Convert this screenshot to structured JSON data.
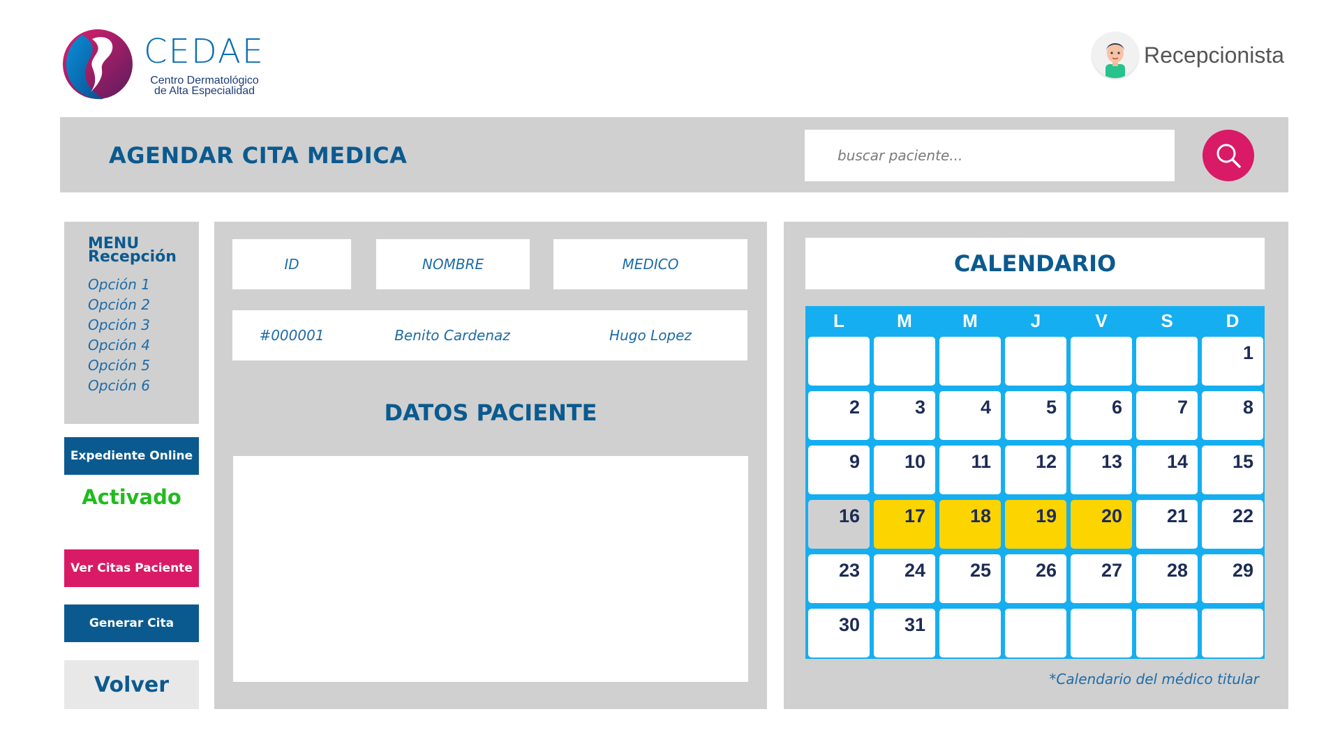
{
  "brand": {
    "name": "CEDAE",
    "subtitle_line1": "Centro Dermatológico",
    "subtitle_line2": "de Alta Especialidad",
    "colors": {
      "blue": "#0a6fb1",
      "magenta": "#d91a66"
    }
  },
  "user": {
    "role": "Recepcionista",
    "avatar_icon": "user-avatar-icon"
  },
  "header": {
    "title": "AGENDAR CITA MEDICA",
    "search_placeholder": "buscar paciente...",
    "search_icon": "search-icon"
  },
  "menu": {
    "title_line1": "MENU",
    "title_line2": "Recepción",
    "items": [
      "Opción 1",
      "Opción 2",
      "Opción 3",
      "Opción 4",
      "Opción 5",
      "Opción 6"
    ]
  },
  "actions": {
    "expediente_label": "Expediente Online",
    "expediente_status": "Activado",
    "ver_citas_label": "Ver Citas Paciente",
    "generar_cita_label": "Generar Cita",
    "volver_label": "Volver"
  },
  "patient": {
    "columns": [
      "ID",
      "NOMBRE",
      "MEDICO"
    ],
    "row": {
      "id": "#000001",
      "nombre": "Benito Cardenaz",
      "medico": "Hugo Lopez"
    },
    "section_title": "DATOS PACIENTE"
  },
  "calendar": {
    "title": "CALENDARIO",
    "weekdays": [
      "L",
      "M",
      "M",
      "J",
      "V",
      "S",
      "D"
    ],
    "weeks": [
      [
        null,
        null,
        null,
        null,
        null,
        null,
        1
      ],
      [
        2,
        3,
        4,
        5,
        6,
        7,
        8
      ],
      [
        9,
        10,
        11,
        12,
        13,
        14,
        15
      ],
      [
        16,
        17,
        18,
        19,
        20,
        21,
        22
      ],
      [
        23,
        24,
        25,
        26,
        27,
        28,
        29
      ],
      [
        30,
        31,
        null,
        null,
        null,
        null,
        null
      ]
    ],
    "highlighted_days": [
      17,
      18,
      19,
      20
    ],
    "grey_days": [
      16
    ],
    "colors": {
      "grid": "#15aef0",
      "highlight": "#fcd400",
      "grey": "#d0d0d0"
    },
    "note": "*Calendario del médico titular"
  }
}
